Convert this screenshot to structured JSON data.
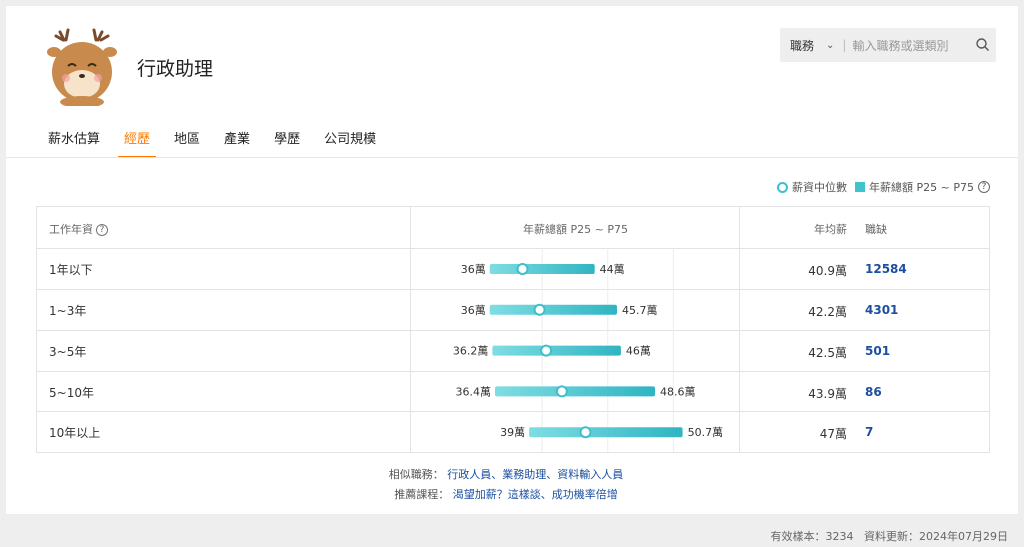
{
  "job": {
    "title": "行政助理"
  },
  "search": {
    "select_label": "職務",
    "placeholder": "輸入職務或選類別"
  },
  "tabs": [
    {
      "label": "薪水估算"
    },
    {
      "label": "經歷"
    },
    {
      "label": "地區"
    },
    {
      "label": "產業"
    },
    {
      "label": "學歷"
    },
    {
      "label": "公司規模"
    }
  ],
  "legend": {
    "median": "薪資中位數",
    "range": "年薪總額 P25 ~ P75"
  },
  "table": {
    "headers": {
      "experience": "工作年資",
      "range": "年薪總額 P25 ~ P75",
      "avg": "年均薪",
      "openings": "職缺"
    }
  },
  "chart_data": {
    "type": "range",
    "unit": "萬",
    "rows": [
      {
        "experience": "1年以下",
        "p25": 36,
        "p75": 44,
        "median": 38.5,
        "p25_label": "36萬",
        "p75_label": "44萬",
        "avg_label": "40.9萬",
        "openings": "12584"
      },
      {
        "experience": "1~3年",
        "p25": 36,
        "p75": 45.7,
        "median": 39.8,
        "p25_label": "36萬",
        "p75_label": "45.7萬",
        "avg_label": "42.2萬",
        "openings": "4301"
      },
      {
        "experience": "3~5年",
        "p25": 36.2,
        "p75": 46,
        "median": 40.3,
        "p25_label": "36.2萬",
        "p75_label": "46萬",
        "avg_label": "42.5萬",
        "openings": "501"
      },
      {
        "experience": "5~10年",
        "p25": 36.4,
        "p75": 48.6,
        "median": 41.5,
        "p25_label": "36.4萬",
        "p75_label": "48.6萬",
        "avg_label": "43.9萬",
        "openings": "86"
      },
      {
        "experience": "10年以上",
        "p25": 39,
        "p75": 50.7,
        "median": 43.3,
        "p25_label": "39萬",
        "p75_label": "50.7萬",
        "avg_label": "47萬",
        "openings": "7"
      }
    ]
  },
  "footer": {
    "similar_label": "相似職務：",
    "similar_links": "行政人員、業務助理、資料輸入人員",
    "recommend_label": "推薦課程：",
    "recommend_link": "渴望加薪？這樣談、成功機率倍增"
  },
  "status": {
    "sample_label": "有效樣本：",
    "sample_value": "3234",
    "update_label": "資料更新：",
    "update_value": "2024年07月29日"
  },
  "colors": {
    "accent": "#ff7800",
    "bar": "#3fc3cd",
    "link": "#1c4fa0"
  }
}
